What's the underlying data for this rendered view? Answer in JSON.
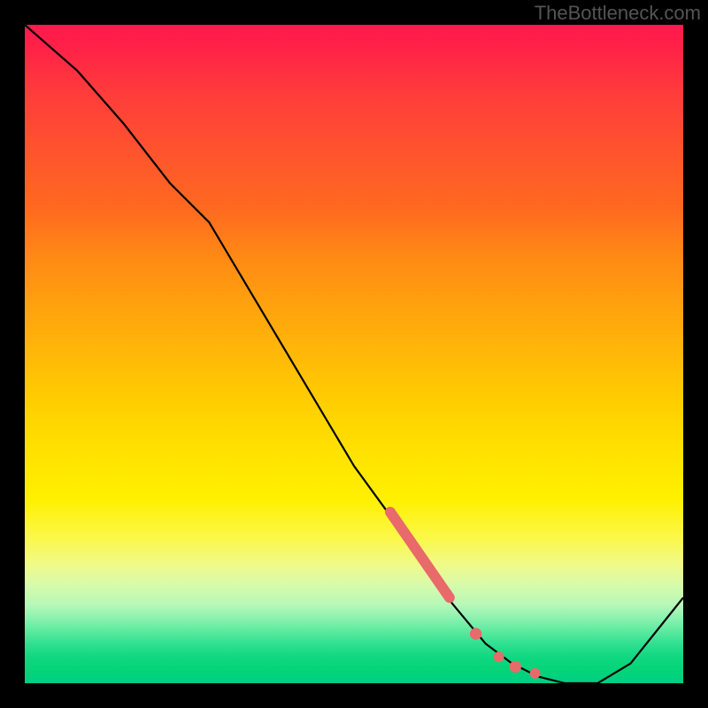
{
  "watermark": "TheBottleneck.com",
  "chart_data": {
    "type": "line",
    "title": "",
    "xlabel": "",
    "ylabel": "",
    "xlim": [
      0,
      100
    ],
    "ylim": [
      0,
      100
    ],
    "series": [
      {
        "name": "main-curve",
        "x": [
          0,
          8,
          15,
          22,
          28,
          50,
          58,
          65,
          70,
          74,
          78,
          82,
          87,
          92,
          100
        ],
        "y": [
          100,
          93,
          85,
          76,
          70,
          33,
          22,
          12,
          6,
          3,
          1,
          0,
          0,
          3,
          13
        ]
      }
    ],
    "markers": [
      {
        "shape": "segment",
        "x0": 55.5,
        "y0": 26,
        "x1": 64.5,
        "y1": 13,
        "width": 1.6,
        "color": "#e86a6a"
      },
      {
        "shape": "dot",
        "x": 68.5,
        "y": 7.5,
        "r": 0.9,
        "color": "#e86a6a"
      },
      {
        "shape": "dot",
        "x": 72.0,
        "y": 4.0,
        "r": 0.8,
        "color": "#e86a6a"
      },
      {
        "shape": "dot",
        "x": 74.5,
        "y": 2.5,
        "r": 0.9,
        "color": "#e86a6a"
      },
      {
        "shape": "dot",
        "x": 77.5,
        "y": 1.5,
        "r": 0.8,
        "color": "#e86a6a"
      }
    ]
  }
}
